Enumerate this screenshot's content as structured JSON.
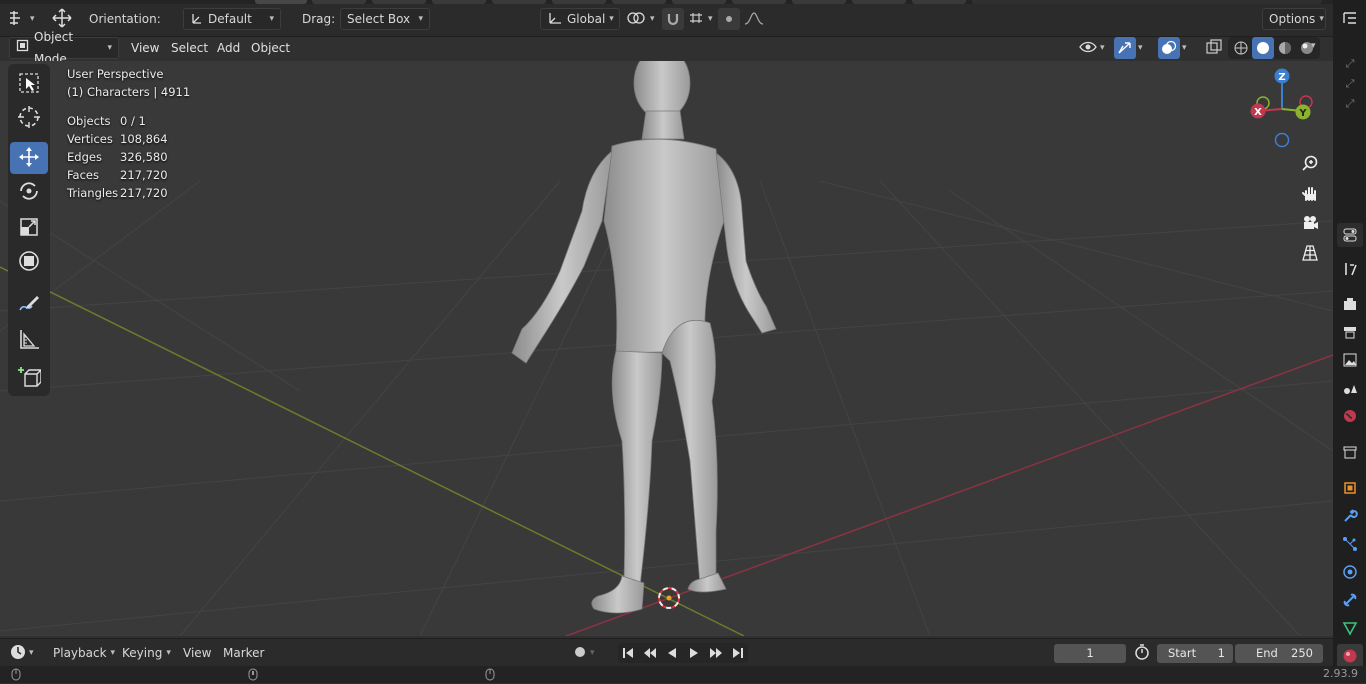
{
  "toolheader": {
    "orientation_label": "Orientation:",
    "orientation_value": "Default",
    "drag_label": "Drag:",
    "drag_value": "Select Box",
    "transform_space": "Global",
    "options_label": "Options"
  },
  "viewport_header": {
    "mode": "Object Mode",
    "menus": [
      "View",
      "Select",
      "Add",
      "Object"
    ]
  },
  "overlay": {
    "perspective": "User Perspective",
    "collection": "(1) Characters | 4911",
    "stats": [
      {
        "label": "Objects",
        "value": "0 / 1"
      },
      {
        "label": "Vertices",
        "value": "108,864"
      },
      {
        "label": "Edges",
        "value": "326,580"
      },
      {
        "label": "Faces",
        "value": "217,720"
      },
      {
        "label": "Triangles",
        "value": "217,720"
      }
    ]
  },
  "gizmo": {
    "z": "Z",
    "y": "Y",
    "x": "X"
  },
  "tools": [
    "select-box-icon",
    "cursor-icon",
    "move-icon",
    "rotate-icon",
    "scale-icon",
    "transform-icon",
    "annotate-icon",
    "measure-icon",
    "add-cube-icon"
  ],
  "timeline": {
    "menus": [
      "Playback",
      "Keying",
      "View",
      "Marker"
    ],
    "current_frame": "1",
    "start_label": "Start",
    "start_value": "1",
    "end_label": "End",
    "end_value": "250"
  },
  "status": {
    "version": "2.93.9"
  },
  "colors": {
    "accent": "#4772b3",
    "x_axis": "#c0394e",
    "y_axis": "#8ab32e",
    "z_axis": "#3b7fd1"
  }
}
